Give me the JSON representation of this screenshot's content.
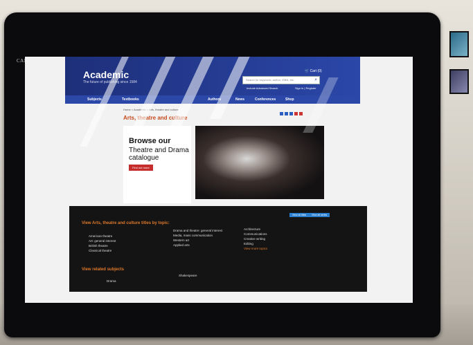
{
  "monitor": {
    "brand": "CAMBRIDGE"
  },
  "site": {
    "title": "Academic",
    "tagline": "The future of publishing since 1584",
    "cart": "Cart (0)",
    "search_placeholder": "Search for keywords, author, ISBN, etc.",
    "advanced_search": "Include Advanced Search",
    "signin": "Sign in | Register"
  },
  "nav": [
    "Subjects",
    "Textbooks",
    "Authors",
    "News",
    "Conferences",
    "Shop"
  ],
  "breadcrumb": "Home > Academic > Arts, theatre and culture",
  "page_title": "Arts, theatre and culture",
  "hero": {
    "heading": "Browse our",
    "subheading": "Theatre and Drama catalogue",
    "button": "Find out more"
  },
  "topics_section": {
    "title": "View Arts, theatre and culture titles by topic:",
    "buttons": [
      "View all titles",
      "View all series"
    ],
    "col1": [
      "American theatre",
      "Art: general interest",
      "British theatre",
      "Classical theatre"
    ],
    "col2": [
      "Drama and theatre: general interest",
      "Media, mass communication",
      "Western art",
      "Applied arts"
    ],
    "col3": [
      "Architecture",
      "Communications",
      "Creative writing",
      "Editing",
      "View more topics"
    ]
  },
  "related": {
    "title": "View related subjects",
    "items": [
      "Drama",
      "Shakespeare"
    ]
  }
}
